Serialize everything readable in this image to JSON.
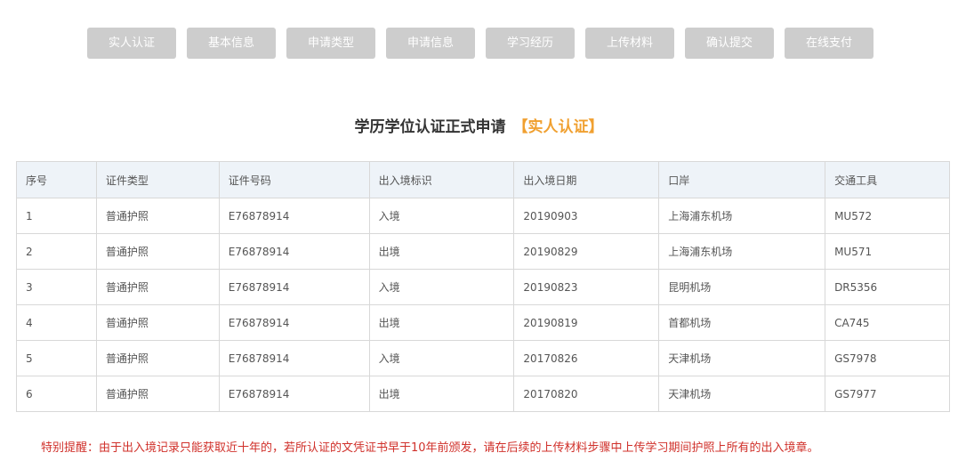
{
  "steps": [
    "实人认证",
    "基本信息",
    "申请类型",
    "申请信息",
    "学习经历",
    "上传材料",
    "确认提交",
    "在线支付"
  ],
  "title": {
    "main": "学历学位认证正式申请",
    "step": "【实人认证】"
  },
  "table": {
    "headers": [
      "序号",
      "证件类型",
      "证件号码",
      "出入境标识",
      "出入境日期",
      "口岸",
      "交通工具"
    ],
    "rows": [
      [
        "1",
        "普通护照",
        "E76878914",
        "入境",
        "20190903",
        "上海浦东机场",
        "MU572"
      ],
      [
        "2",
        "普通护照",
        "E76878914",
        "出境",
        "20190829",
        "上海浦东机场",
        "MU571"
      ],
      [
        "3",
        "普通护照",
        "E76878914",
        "入境",
        "20190823",
        "昆明机场",
        "DR5356"
      ],
      [
        "4",
        "普通护照",
        "E76878914",
        "出境",
        "20190819",
        "首都机场",
        "CA745"
      ],
      [
        "5",
        "普通护照",
        "E76878914",
        "入境",
        "20170826",
        "天津机场",
        "GS7978"
      ],
      [
        "6",
        "普通护照",
        "E76878914",
        "出境",
        "20170820",
        "天津机场",
        "GS7977"
      ]
    ]
  },
  "notice": "特别提醒：由于出入境记录只能获取近十年的，若所认证的文凭证书早于10年前颁发，请在后续的上传材料步骤中上传学习期间护照上所有的出入境章。",
  "colors": {
    "step_bg": "#cdcdcd",
    "accent": "#f0a030",
    "notice": "#d0302a",
    "header_bg": "#eef3f8"
  }
}
